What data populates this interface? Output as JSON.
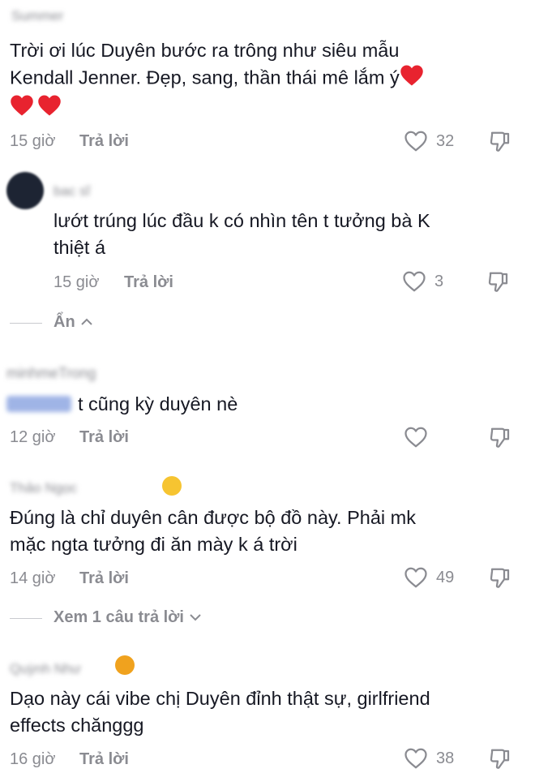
{
  "comments": [
    {
      "username": "Summer",
      "text_line1": "Trời ơi lúc Duyên bước ra trông như siêu mẫu",
      "text_line2": "Kendall Jenner. Đẹp, sang, thần thái mê lắm ý",
      "time": "15 giờ",
      "reply_label": "Trả lời",
      "likes": "32"
    },
    {
      "username": "bac sĩ",
      "text_line1": "lướt trúng lúc đầu k có nhìn tên t tưởng bà K",
      "text_line2": "thiệt á",
      "time": "15 giờ",
      "reply_label": "Trả lời",
      "likes": "3"
    },
    {
      "username": "minhmeTrong",
      "mention": "@user",
      "text_line1": "t cũng kỳ duyên nè",
      "time": "12 giờ",
      "reply_label": "Trả lời",
      "likes": ""
    },
    {
      "username": "Thảo Ngọc",
      "text_line1": "Đúng là chỉ duyên cân được bộ đồ này. Phải mk",
      "text_line2": "mặc ngta tưởng đi ăn mày k á trời",
      "time": "14 giờ",
      "reply_label": "Trả lời",
      "likes": "49"
    },
    {
      "username": "Quỳnh Như",
      "text_line1": "Dạo này cái vibe chị Duyên đỉnh thật sự, girlfriend",
      "text_line2": "effects chănggg",
      "time": "16 giờ",
      "reply_label": "Trả lời",
      "likes": "38"
    }
  ],
  "hide_replies_label": "Ẩn",
  "view_replies_label": "Xem 1 câu trả lời",
  "icons": {
    "like": "heart-outline-icon",
    "dislike": "thumbs-down-icon",
    "heart_emoji": "red-heart-emoji"
  },
  "colors": {
    "text": "#161823",
    "muted": "#8a8b91",
    "heart": "#e8232f"
  }
}
